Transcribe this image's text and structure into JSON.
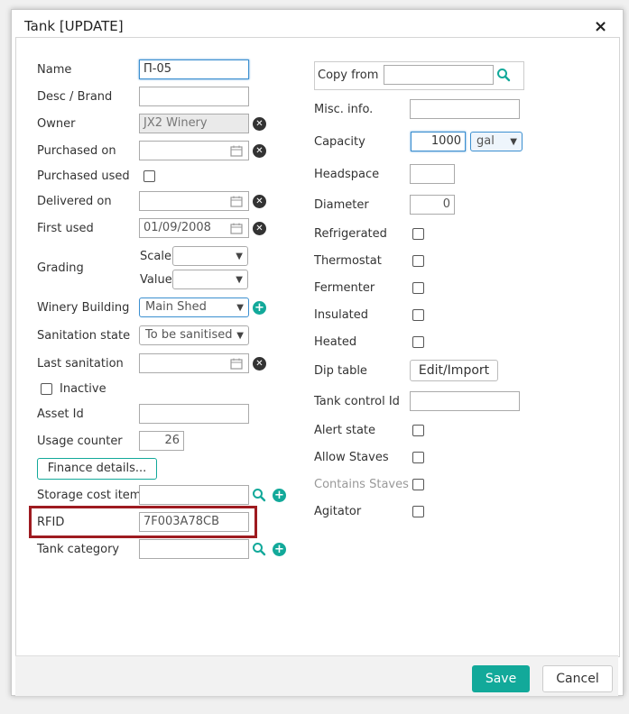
{
  "dialog": {
    "title": "Tank [UPDATE]",
    "close": "×"
  },
  "left": {
    "name": {
      "label": "Name",
      "value": "П-05"
    },
    "desc": {
      "label": "Desc / Brand",
      "value": ""
    },
    "owner": {
      "label": "Owner",
      "value": "JX2 Winery"
    },
    "purchased_on": {
      "label": "Purchased on",
      "value": ""
    },
    "purchased_used": {
      "label": "Purchased used"
    },
    "delivered_on": {
      "label": "Delivered on",
      "value": ""
    },
    "first_used": {
      "label": "First used",
      "value": "01/09/2008"
    },
    "grading": {
      "label": "Grading",
      "scale_label": "Scale",
      "value_label": "Value",
      "scale_value": "",
      "value_value": ""
    },
    "winery_building": {
      "label": "Winery Building",
      "value": "Main Shed"
    },
    "sanitation_state": {
      "label": "Sanitation state",
      "value": "To be sanitised"
    },
    "last_sanitation": {
      "label": "Last sanitation",
      "value": ""
    },
    "inactive": {
      "label": "Inactive"
    },
    "asset_id": {
      "label": "Asset Id",
      "value": ""
    },
    "usage_counter": {
      "label": "Usage counter",
      "value": "26"
    },
    "finance_button": "Finance details...",
    "storage_cost_item": {
      "label": "Storage cost item",
      "value": ""
    },
    "rfid": {
      "label": "RFID",
      "value": "7F003A78CB"
    },
    "tank_category": {
      "label": "Tank category",
      "value": ""
    }
  },
  "right": {
    "copy_from": {
      "label": "Copy from",
      "value": ""
    },
    "misc_info": {
      "label": "Misc. info.",
      "value": ""
    },
    "capacity": {
      "label": "Capacity",
      "value": "1000",
      "unit": "gal"
    },
    "headspace": {
      "label": "Headspace",
      "value": ""
    },
    "diameter": {
      "label": "Diameter",
      "value": "0"
    },
    "refrigerated": {
      "label": "Refrigerated"
    },
    "thermostat": {
      "label": "Thermostat"
    },
    "fermenter": {
      "label": "Fermenter"
    },
    "insulated": {
      "label": "Insulated"
    },
    "heated": {
      "label": "Heated"
    },
    "dip_table": {
      "label": "Dip table",
      "button": "Edit/Import"
    },
    "tank_control_id": {
      "label": "Tank control Id",
      "value": ""
    },
    "alert_state": {
      "label": "Alert state"
    },
    "allow_staves": {
      "label": "Allow Staves"
    },
    "contains_staves": {
      "label": "Contains Staves"
    },
    "agitator": {
      "label": "Agitator"
    }
  },
  "footer": {
    "save": "Save",
    "cancel": "Cancel"
  },
  "colors": {
    "accent": "#12a99a",
    "highlight": "#9e1b20",
    "focus": "#3b8fd0"
  },
  "icons": {
    "remove": "x-circle-icon",
    "add": "plus-circle-icon",
    "search": "search-icon",
    "calendar": "calendar-icon",
    "dropdown": "triangle-down-icon"
  }
}
